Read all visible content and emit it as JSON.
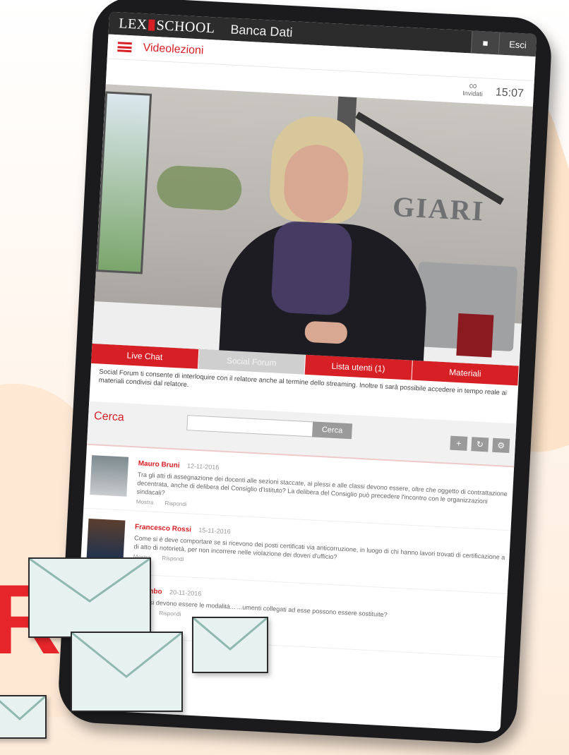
{
  "app": {
    "logo_left": "LEX",
    "logo_right": "SCHOOL",
    "product": "Banca Dati",
    "exit_label": "Esci",
    "user_icon": "user-icon"
  },
  "section": {
    "title": "Videolezioni",
    "menu_icon": "hamburger-menu-icon"
  },
  "status": {
    "time": "15:07",
    "link_label": "Invidati",
    "link_icon": "link-icon"
  },
  "video": {
    "wall_letters": "GIARI"
  },
  "tabs": [
    {
      "label": "Live Chat",
      "active": true
    },
    {
      "label": "Social Forum",
      "active": false
    },
    {
      "label": "Lista utenti (1)",
      "active": true
    },
    {
      "label": "Materiali",
      "active": true
    }
  ],
  "description": "Social Forum ti consente di interloquire con il relatore anche al termine dello streaming. Inoltre ti sarà possibile accedere in tempo reale ai materiali condivisi dal relatore.",
  "search": {
    "label": "Cerca",
    "placeholder": "",
    "button": "Cerca",
    "icons": [
      "plus-icon",
      "refresh-icon",
      "settings-icon"
    ]
  },
  "posts": [
    {
      "name": "Mauro Bruni",
      "date": "12-11-2016",
      "text": "Tra gli atti di assegnazione dei docenti alle sezioni staccate, ai plessi e alle classi devono essere, oltre che oggetto di contrattazione decentrata, anche di delibera del Consiglio d'Istituto? La delibera del Consiglio può precedere l'incontro con le organizzazioni sindacali?",
      "actions": [
        "Mostra",
        "Rispondi"
      ]
    },
    {
      "name": "Francesco Rossi",
      "date": "15-11-2016",
      "text": "Come si è deve comportare se si ricevono dei posti certificati via anticorruzione, in luogo di chi hanno lavori trovati di certificazione a di atto di notorietà, per non incorrere nelle violazione dei doveri d'ufficio?",
      "actions": [
        "Mostra",
        "Rispondi"
      ]
    },
    {
      "name": "Colombo",
      "date": "20-11-2016",
      "text": "Come si devono essere le modalità... ...umenti collegati ad esse possono essere sostituite?",
      "actions": [
        "Mostra",
        "Rispondi"
      ]
    }
  ],
  "overlay": {
    "big_letter": "R"
  }
}
